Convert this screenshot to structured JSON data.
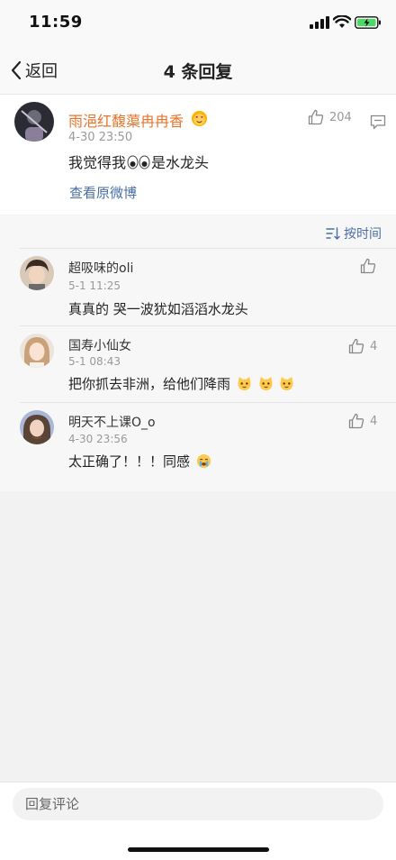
{
  "status": {
    "time": "11:59"
  },
  "nav": {
    "back_label": "返回",
    "title": "4 条回复"
  },
  "post": {
    "author": "雨浥红馥蕖冉冉香",
    "date": "4-30 23:50",
    "text_before": "我觉得我",
    "text_after": "是水龙头",
    "likes": "204",
    "view_original": "查看原微博"
  },
  "sort": {
    "label": "按时间"
  },
  "replies": [
    {
      "name": "超吸味的oli",
      "date": "5-1 11:25",
      "text": "真真的 哭一波犹如滔滔水龙头",
      "likes": ""
    },
    {
      "name": "国寿小仙女",
      "date": "5-1 08:43",
      "text": "把你抓去非洲，给他们降雨",
      "likes": "4"
    },
    {
      "name": "明天不上课O_o",
      "date": "4-30 23:56",
      "text": "太正确了！！！同感",
      "likes": "4"
    }
  ],
  "footer": {
    "placeholder": "回复评论"
  },
  "colors": {
    "author": "#e8742c",
    "link": "#4a6fa5",
    "battery": "#4cd964"
  }
}
